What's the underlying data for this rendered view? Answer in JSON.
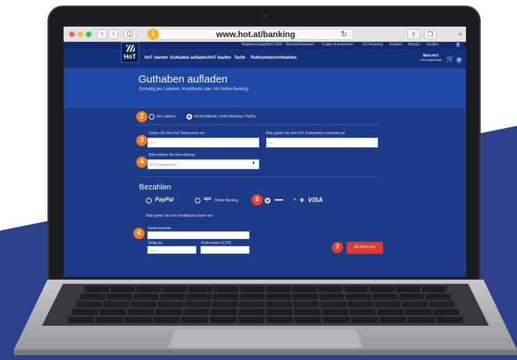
{
  "colors": {
    "site_blue": "#13307a",
    "hero_blue": "#1e47a6",
    "accent_red": "#d93b2c",
    "badge_orange": "#f47a20",
    "bg_blue": "#2c3e8a"
  },
  "browser": {
    "url": "www.hot.at/banking",
    "icons": [
      "back-icon",
      "forward-icon",
      "sidebar-icon",
      "reload-icon",
      "share-icon",
      "tabs-icon",
      "plus-icon"
    ]
  },
  "site": {
    "logo_text": "HoT",
    "top_links": [
      "Registrierungspflicht 2019",
      "Wechsel Assistent",
      "Fragen & Antworten",
      "EU-Roaming",
      "Ausland",
      "Handys",
      "English"
    ],
    "nav": [
      "HoT starten",
      "Guthaben aufladen",
      "HoT kaufen",
      "Tarife",
      "Rufnummernmitnahme"
    ],
    "account_title": "Mein HoT",
    "account_sub": "nicht angemeldet",
    "cart_count": "0"
  },
  "page": {
    "title": "Guthaben aufladen",
    "subtitle": "Einmalig per Ladebon, Kreditkarte oder mit Online-Banking"
  },
  "form": {
    "method_options": [
      "mit Ladebon",
      "mit Kreditkarte, Online Banking, PayPal"
    ],
    "selected_method": "mit Kreditkarte, Online Banking, PayPal",
    "phone_label": "Geben Sie Ihre HoT Rufnummer ein",
    "phone_repeat_label": "Bitte geben Sie Ihre HoT Rufnummer nochmals ein",
    "phone_placeholder": "0677",
    "amount_label": "Bitte wählen Sie einen Betrag",
    "amount_value": "BITTE AUSWÄHLEN",
    "pay_heading": "Bezahlen",
    "pay_options": [
      "PayPal",
      "eps Online Banking",
      "Kreditkarte"
    ],
    "eps_text": "Online Banking",
    "visa_text": "VISA",
    "card_hint": "Bitte geben Sie Ihre Kreditkarten-Daten ein",
    "card_number_label": "Kartennummer",
    "valid_label": "Gültig bis",
    "valid_placeholder": "MM/YY",
    "cvn_label": "Prüfnummer (CVN)",
    "submit_label": "BEZAHLEN"
  },
  "steps": [
    "1",
    "2",
    "3",
    "4",
    "5",
    "6",
    "7"
  ]
}
